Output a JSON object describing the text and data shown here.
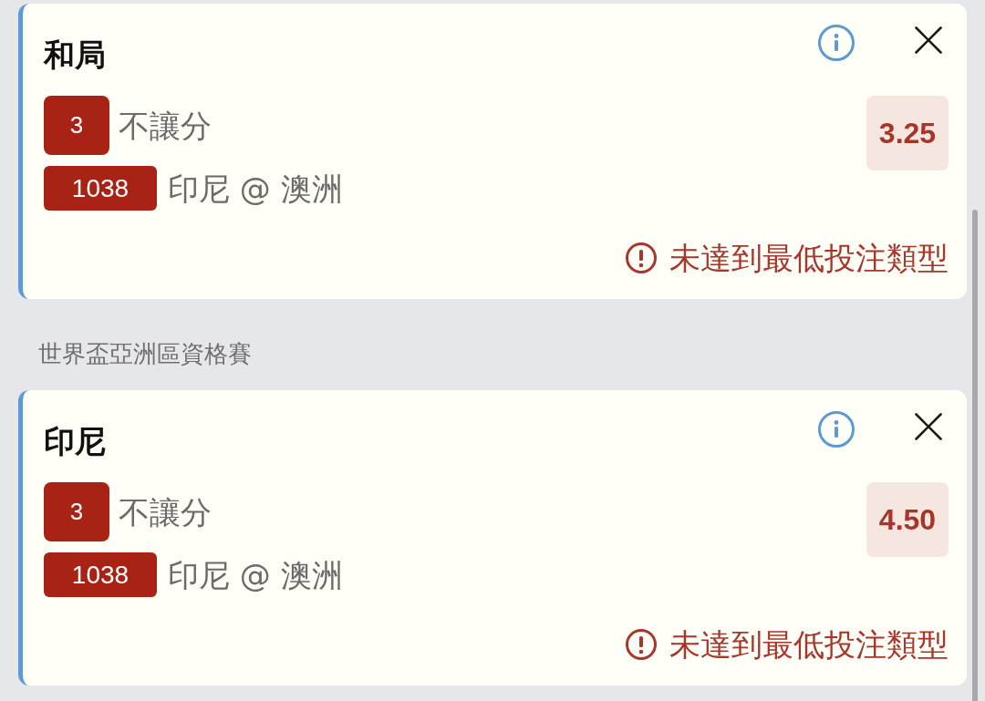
{
  "selections": [
    {
      "title": "和局",
      "market_code": "3",
      "market": "不讓分",
      "match_code": "1038",
      "match": "印尼 @ 澳洲",
      "odds": "3.25",
      "warning": "未達到最低投注類型"
    },
    {
      "league": "世界盃亞洲區資格賽",
      "title": "印尼",
      "market_code": "3",
      "market": "不讓分",
      "match_code": "1038",
      "match": "印尼 @ 澳洲",
      "odds": "4.50",
      "warning": "未達到最低投注類型"
    }
  ]
}
